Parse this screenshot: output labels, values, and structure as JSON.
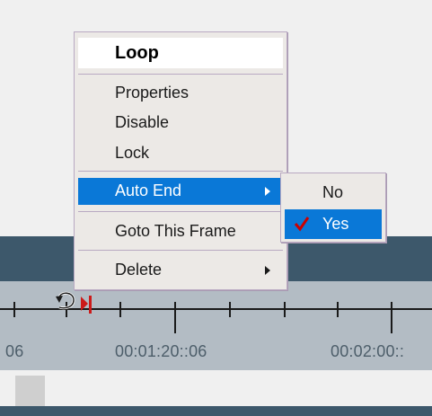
{
  "context_menu": {
    "header": "Loop",
    "items": [
      {
        "label": "Properties"
      },
      {
        "label": "Disable"
      },
      {
        "label": "Lock"
      },
      {
        "label": "Auto End"
      },
      {
        "label": "Goto This Frame"
      },
      {
        "label": "Delete"
      }
    ]
  },
  "submenu": {
    "items": [
      {
        "label": "No"
      },
      {
        "label": "Yes",
        "checked": true
      }
    ]
  },
  "timeline": {
    "ruler_labels": [
      "06",
      "00:01:20::06",
      "00:02:00::"
    ]
  },
  "colors": {
    "highlight": "#0a78d7",
    "menu_bg": "#ece9e6",
    "track_band": "#3d586b",
    "ruler_bg": "#b3bcc4",
    "check_mark": "#cc0000"
  },
  "icons": {
    "loop_marker": "loop-arrow-icon",
    "end_marker": "red-end-marker-icon",
    "submenu_arrow": "chevron-right-icon",
    "check": "check-icon"
  }
}
